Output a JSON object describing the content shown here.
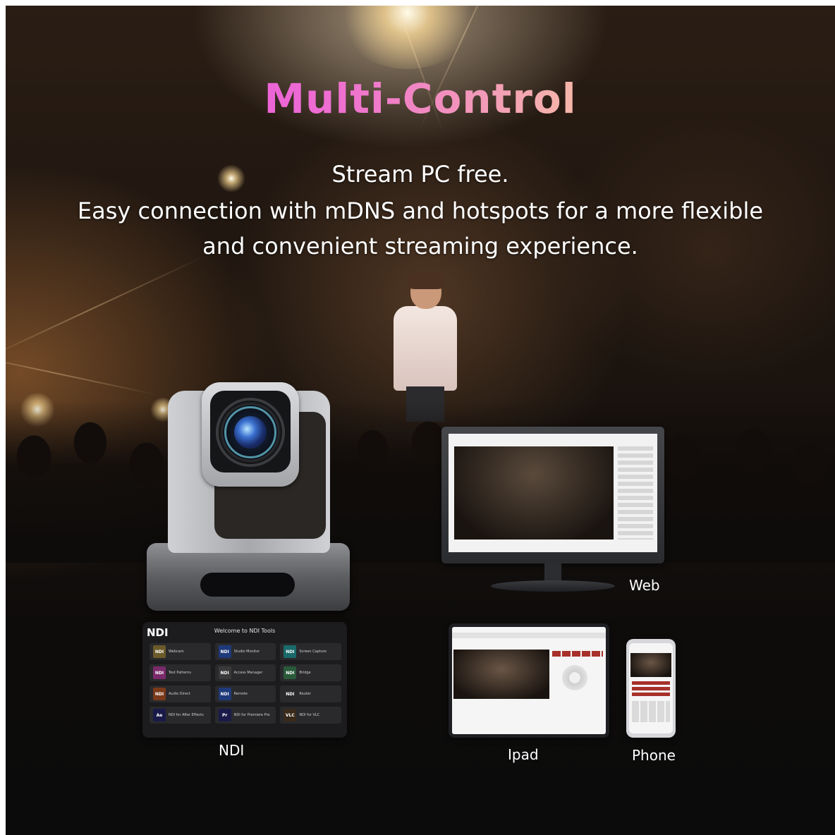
{
  "header": {
    "title": "Multi-Control",
    "subtitle_lines": [
      "Stream PC free.",
      "Easy connection with mDNS and hotspots for a more flexible",
      "and convenient streaming experience."
    ]
  },
  "colors": {
    "title_gradient": [
      "#e23df0",
      "#ee6fd0",
      "#f7c6a0",
      "#ffe89a"
    ],
    "text": "#ffffff",
    "background": "#0b0b0b",
    "control_red": "#a8302a"
  },
  "devices": {
    "web": {
      "label": "Web",
      "icon": "monitor-icon"
    },
    "ndi": {
      "label": "NDI",
      "icon": "ndi-tools-icon"
    },
    "ipad": {
      "label": "Ipad",
      "icon": "tablet-icon"
    },
    "phone": {
      "label": "Phone",
      "icon": "phone-icon"
    }
  },
  "ndi_panel": {
    "logo": "NDI",
    "title": "Welcome to NDI Tools",
    "tools": [
      {
        "icon_text": "NDI",
        "name": "Webcam",
        "color": "#6b5a2a"
      },
      {
        "icon_text": "NDI",
        "name": "Studio Monitor",
        "color": "#1f3a7a"
      },
      {
        "icon_text": "NDI",
        "name": "Screen Capture",
        "color": "#1a6a6a"
      },
      {
        "icon_text": "NDI",
        "name": "Test Patterns",
        "color": "#7a2a6a"
      },
      {
        "icon_text": "NDI",
        "name": "Access Manager",
        "color": "#3a3a3a"
      },
      {
        "icon_text": "NDI",
        "name": "Bridge",
        "color": "#2a5a3a"
      },
      {
        "icon_text": "NDI",
        "name": "Audio Direct",
        "color": "#7a3a1a"
      },
      {
        "icon_text": "NDI",
        "name": "Remote",
        "color": "#1f3a7a"
      },
      {
        "icon_text": "NDI",
        "name": "Router",
        "color": "#2a2a2d"
      },
      {
        "icon_text": "Ae",
        "name": "NDI for After Effects",
        "color": "#1a1a4a"
      },
      {
        "icon_text": "Pr",
        "name": "NDI for Premiere Pro",
        "color": "#1a1a4a"
      },
      {
        "icon_text": "VLC",
        "name": "NDI for VLC",
        "color": "#3a2a1a"
      }
    ]
  }
}
